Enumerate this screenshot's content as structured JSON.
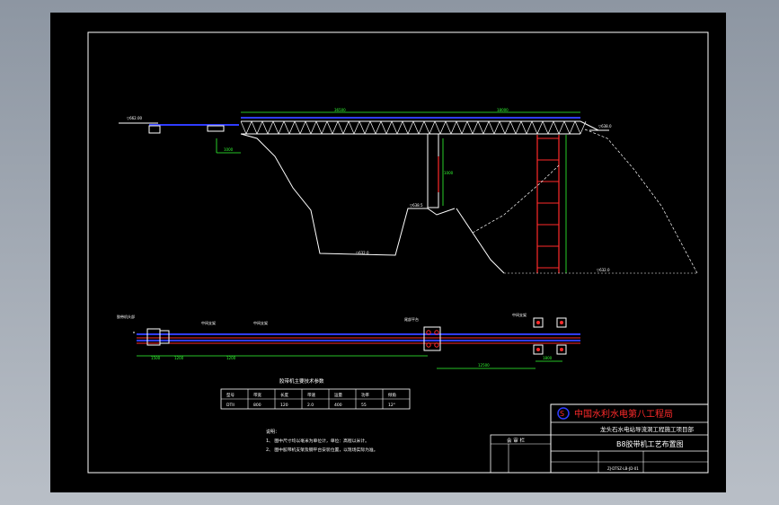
{
  "title_block": {
    "org_name": "中国水利水电第八工程局",
    "project": "龙头石水电站导流洞工程施工项目部",
    "drawing_title": "B8胶带机工艺布置图",
    "review_label": "会 审 栏",
    "footer_code": "ZJ-DTSZ-LB-JD-01"
  },
  "notes": {
    "heading": "说明：",
    "line1": "1、  图中尺寸均以毫米为单位计，单位：高程以米计。",
    "line2": "2、  图中胶带机支架及钢平台安装位置，以现场实际为准。"
  },
  "table": {
    "title": "胶带机主要技术参数",
    "headers": [
      "型号",
      "带宽",
      "长度",
      "带速",
      "运量",
      "功率",
      "倾角"
    ],
    "row": [
      "DTII",
      "800",
      "120",
      "2.0",
      "400",
      "55",
      "12°"
    ]
  },
  "elevation": {
    "dims": [
      "36500",
      "18000",
      "1000",
      "1000"
    ],
    "levels": [
      "▽662.00",
      "▽638.5",
      "▽632.0",
      "▽632.0",
      "▽638.0"
    ]
  },
  "plan": {
    "dims": [
      "1500",
      "1200",
      "1200",
      "12500",
      "1800"
    ],
    "labels": [
      "胶带机头部",
      "中间支架",
      "中间支架",
      "尾部平台",
      "中间支架"
    ]
  },
  "colors": {
    "frame": "#ffffff",
    "conveyor": "#2f3cff",
    "tower": "#ff2a2a",
    "dims": "#33ff33",
    "terrain": "#ffffff"
  }
}
